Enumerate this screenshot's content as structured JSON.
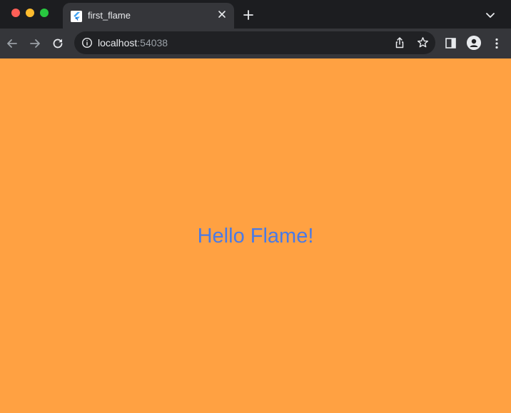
{
  "window": {
    "controls": [
      "close-icon",
      "minimize-icon",
      "maximize-icon"
    ]
  },
  "tab": {
    "title": "first_flame",
    "favicon": "flutter-icon",
    "close_icon": "close-icon"
  },
  "tabstrip": {
    "new_tab_icon": "plus-icon",
    "tab_search_icon": "chevron-down-icon"
  },
  "toolbar": {
    "back_icon": "arrow-left-icon",
    "forward_icon": "arrow-right-icon",
    "reload_icon": "reload-icon",
    "address": {
      "info_icon": "info-icon",
      "host": "localhost",
      "port": ":54038",
      "share_icon": "share-icon",
      "bookmark_icon": "star-icon"
    },
    "side_panel_icon": "side-panel-icon",
    "profile_icon": "profile-icon",
    "menu_icon": "more-vertical-icon"
  },
  "page": {
    "background_color": "#ffa142",
    "heading": "Hello Flame!",
    "heading_color": "#4a7ae5"
  }
}
